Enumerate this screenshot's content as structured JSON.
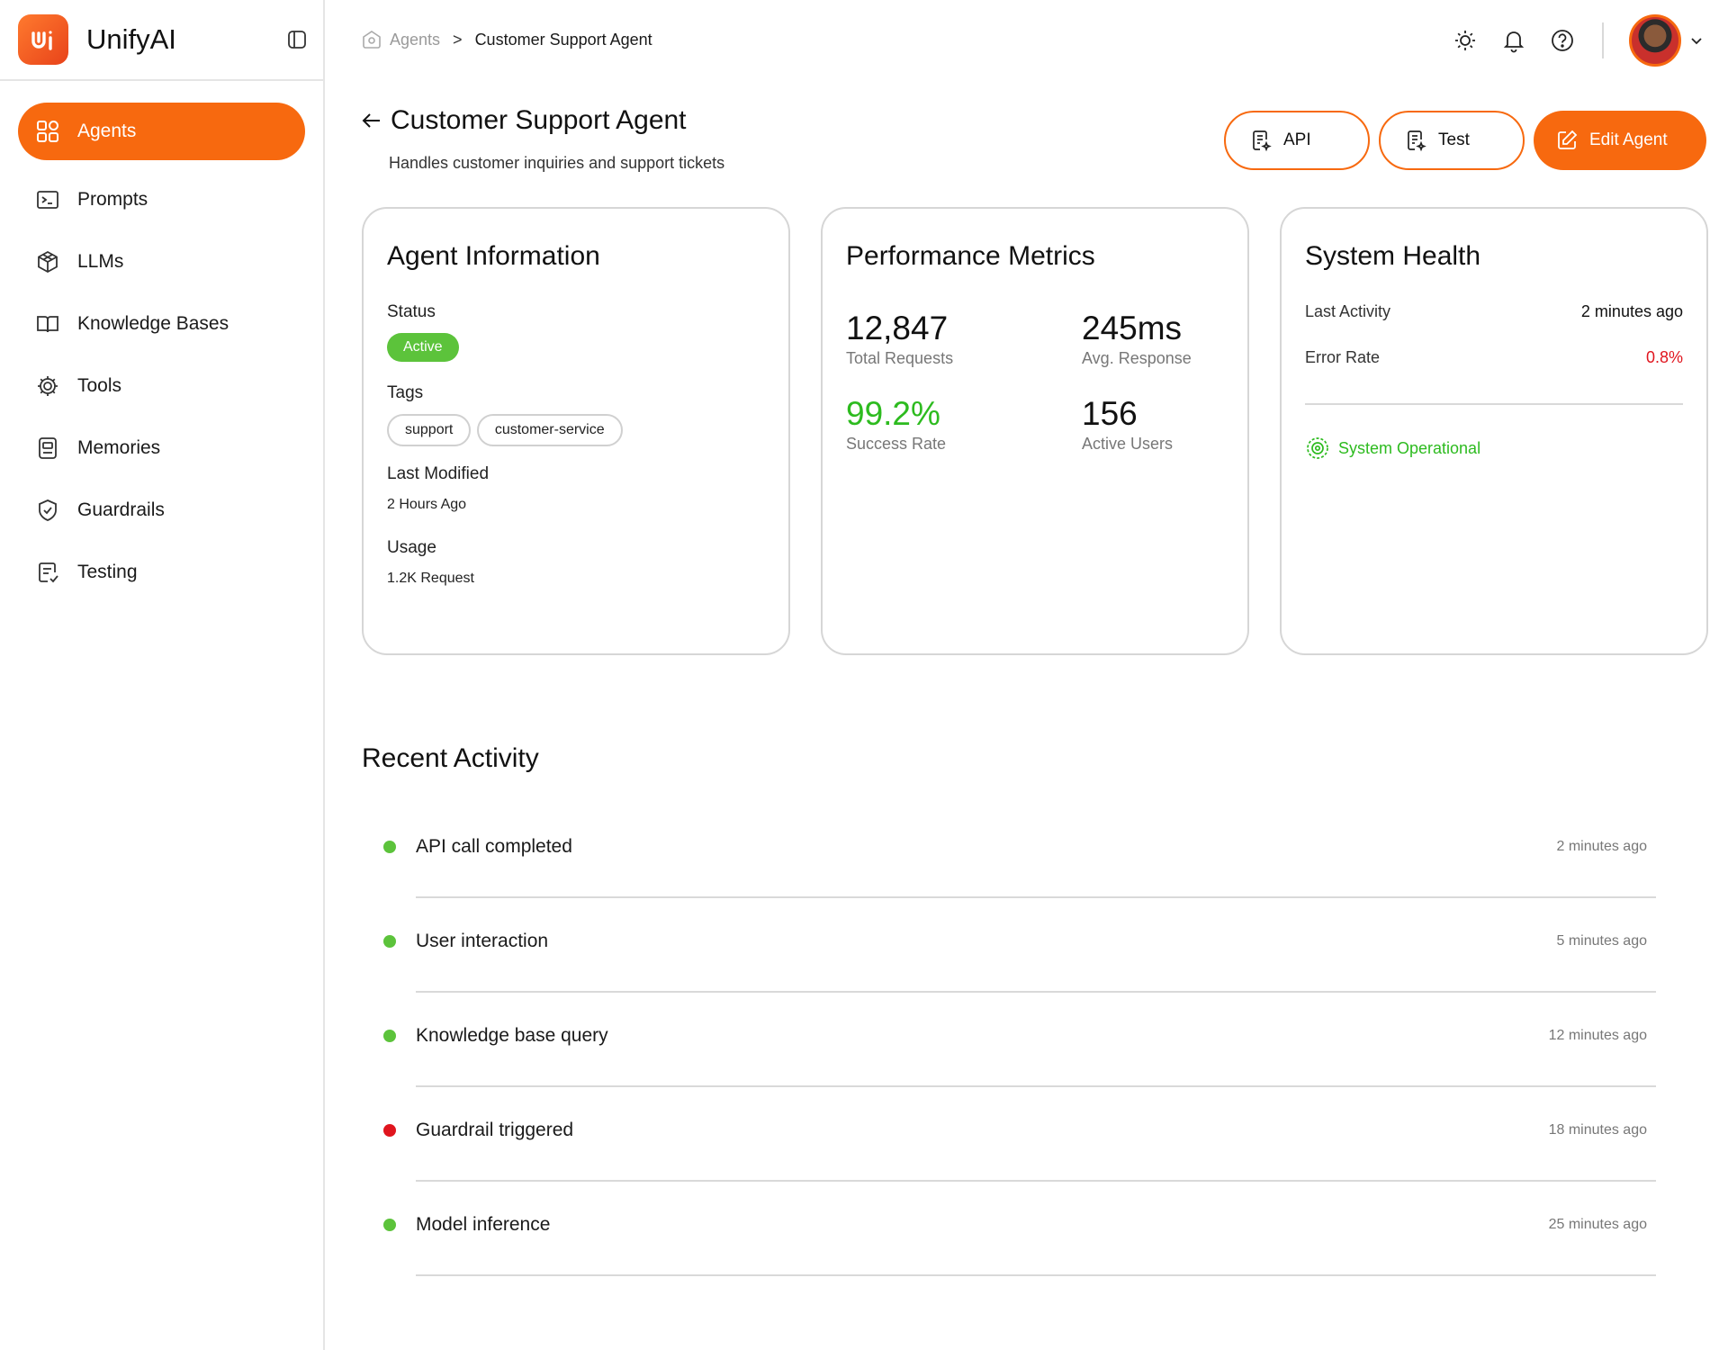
{
  "app": {
    "name": "UnifyAI"
  },
  "sidebar": {
    "items": [
      {
        "label": "Agents",
        "icon": "grid-icon",
        "active": true
      },
      {
        "label": "Prompts",
        "icon": "terminal-icon"
      },
      {
        "label": "LLMs",
        "icon": "cube-icon"
      },
      {
        "label": "Knowledge Bases",
        "icon": "book-icon"
      },
      {
        "label": "Tools",
        "icon": "gear-icon"
      },
      {
        "label": "Memories",
        "icon": "memory-card-icon"
      },
      {
        "label": "Guardrails",
        "icon": "shield-icon"
      },
      {
        "label": "Testing",
        "icon": "checklist-icon"
      }
    ]
  },
  "breadcrumb": {
    "parent": "Agents",
    "separator": ">",
    "current": "Customer Support Agent"
  },
  "header": {
    "title": "Customer Support Agent",
    "subtitle": "Handles customer inquiries and support tickets",
    "buttons": {
      "api": "API",
      "test": "Test",
      "edit": "Edit Agent"
    }
  },
  "agent_info": {
    "title": "Agent Information",
    "status_label": "Status",
    "status_value": "Active",
    "tags_label": "Tags",
    "tags": [
      "support",
      "customer-service"
    ],
    "last_modified_label": "Last Modified",
    "last_modified_value": "2 Hours Ago",
    "usage_label": "Usage",
    "usage_value": "1.2K Request"
  },
  "performance": {
    "title": "Performance Metrics",
    "metrics": [
      {
        "value": "12,847",
        "caption": "Total Requests"
      },
      {
        "value": "245ms",
        "caption": "Avg. Response"
      },
      {
        "value": "99.2%",
        "caption": "Success Rate"
      },
      {
        "value": "156",
        "caption": "Active Users"
      }
    ]
  },
  "health": {
    "title": "System Health",
    "last_activity_label": "Last Activity",
    "last_activity_value": "2 minutes ago",
    "error_rate_label": "Error Rate",
    "error_rate_value": "0.8%",
    "status": "System Operational"
  },
  "recent_activity": {
    "title": "Recent Activity",
    "items": [
      {
        "label": "API call completed",
        "time": "2 minutes ago",
        "status": "success"
      },
      {
        "label": "User interaction",
        "time": "5 minutes ago",
        "status": "success"
      },
      {
        "label": "Knowledge base query",
        "time": "12 minutes ago",
        "status": "success"
      },
      {
        "label": "Guardrail triggered",
        "time": "18 minutes ago",
        "status": "error"
      },
      {
        "label": "Model inference",
        "time": "25 minutes ago",
        "status": "success"
      }
    ]
  },
  "colors": {
    "accent": "#f7690f",
    "success": "#5cc33b",
    "success_text": "#2dbb1f",
    "error": "#e0151e"
  }
}
